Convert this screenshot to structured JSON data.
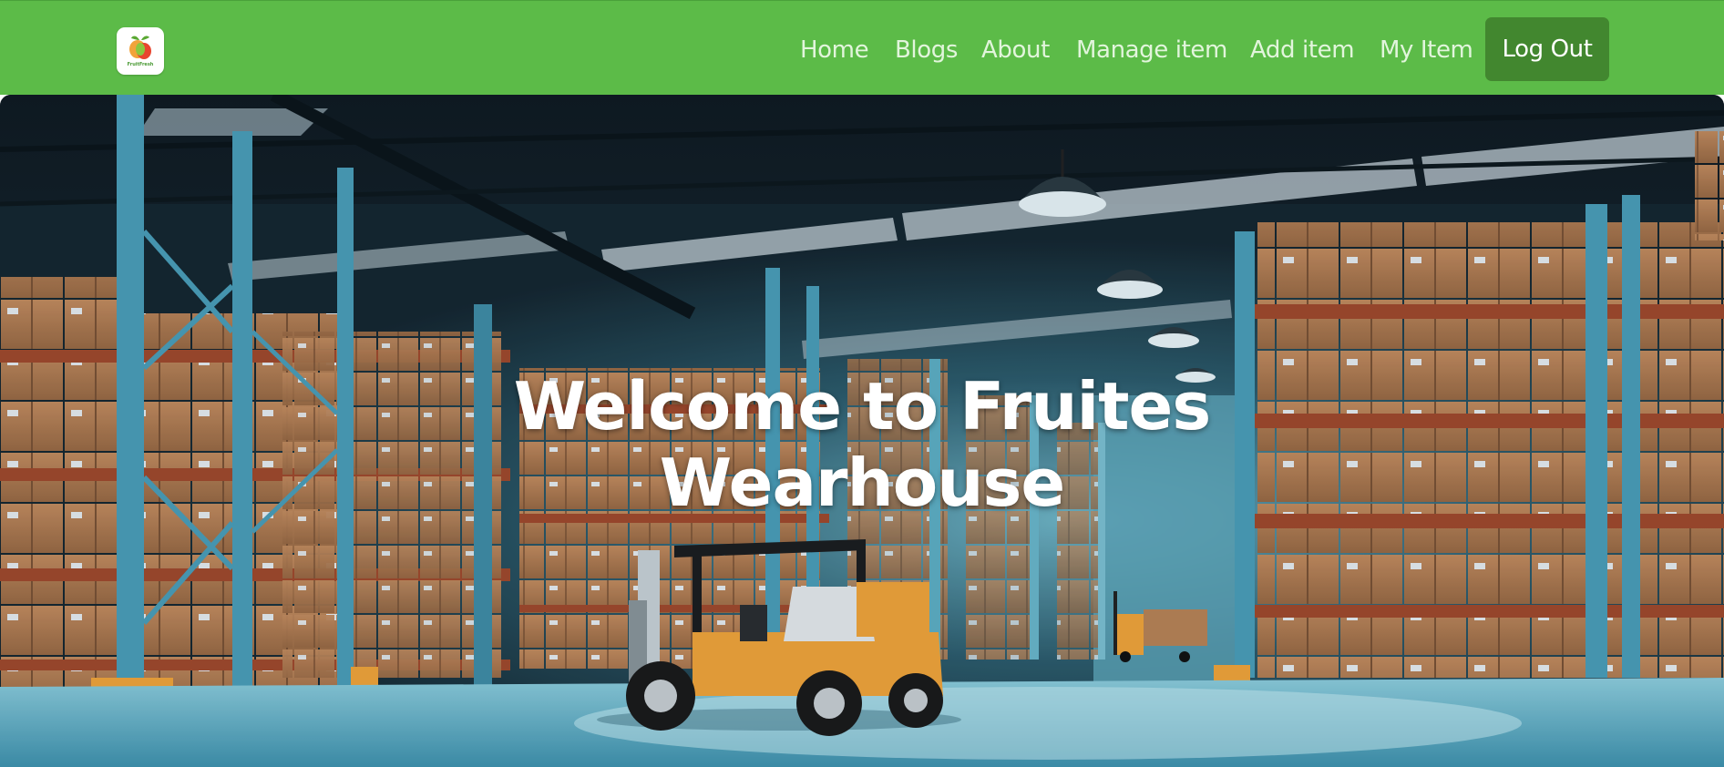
{
  "brand": {
    "logo_text": "FruitFresh",
    "icon": "fruit-logo-icon"
  },
  "nav": {
    "links": [
      {
        "label": "Home"
      },
      {
        "label": "Blogs"
      },
      {
        "label": "About"
      },
      {
        "label": "Manage item"
      },
      {
        "label": "Add item"
      },
      {
        "label": "My Item"
      }
    ],
    "logout_label": "Log Out"
  },
  "hero": {
    "title": "Welcome to Fruites Wearhouse",
    "background": "warehouse-with-forklift"
  },
  "colors": {
    "navbar": "#5cbb48",
    "nav_link": "#e2f5dc",
    "logout_button": "#42872f",
    "forklift": "#f2a53a"
  }
}
